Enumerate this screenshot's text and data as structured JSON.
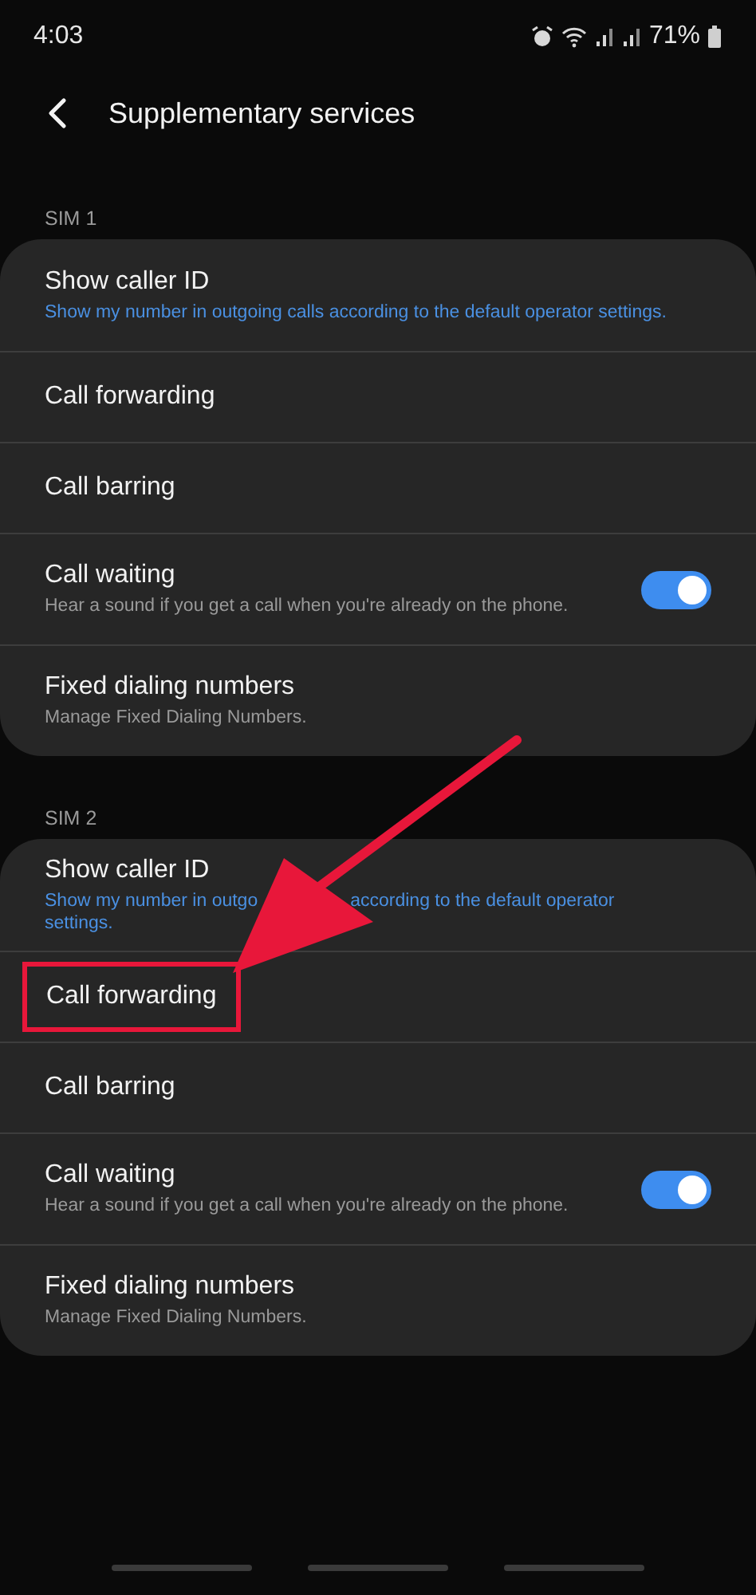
{
  "status_bar": {
    "time": "4:03",
    "battery": "71%"
  },
  "header": {
    "title": "Supplementary services"
  },
  "sections": [
    {
      "label": "SIM 1",
      "items": [
        {
          "kind": "info",
          "title": "Show caller ID",
          "description": "Show my number in outgoing calls according to the default operator settings.",
          "highlighted": false
        },
        {
          "kind": "plain",
          "title": "Call forwarding",
          "highlighted": false
        },
        {
          "kind": "plain",
          "title": "Call barring",
          "highlighted": false
        },
        {
          "kind": "toggle",
          "title": "Call waiting",
          "description": "Hear a sound if you get a call when you're already on the phone.",
          "on": true,
          "highlighted": false
        },
        {
          "kind": "plain",
          "title": "Fixed dialing numbers",
          "description": "Manage Fixed Dialing Numbers.",
          "highlighted": false
        }
      ]
    },
    {
      "label": "SIM 2",
      "items": [
        {
          "kind": "info",
          "title": "Show caller ID",
          "description_lines": [
            [
              "Show my number in outgo",
              "according to the default operator"
            ],
            [
              "settings."
            ]
          ],
          "highlighted": false
        },
        {
          "kind": "plain",
          "title": "Call forwarding",
          "highlighted": true
        },
        {
          "kind": "plain",
          "title": "Call barring",
          "highlighted": false
        },
        {
          "kind": "toggle",
          "title": "Call waiting",
          "description": "Hear a sound if you get a call when you're already on the phone.",
          "on": true,
          "highlighted": false
        },
        {
          "kind": "plain",
          "title": "Fixed dialing numbers",
          "description": "Manage Fixed Dialing Numbers.",
          "highlighted": false
        }
      ]
    }
  ]
}
